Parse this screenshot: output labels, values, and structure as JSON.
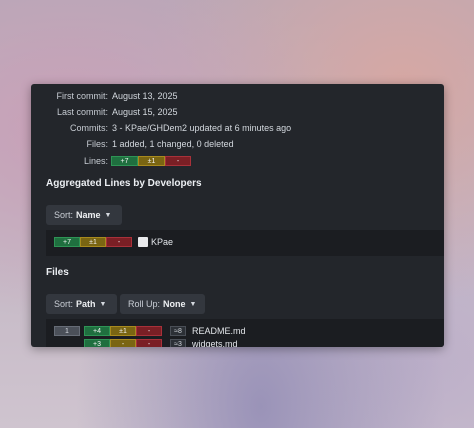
{
  "summary": {
    "first_commit_label": "First commit:",
    "first_commit_value": "August 13, 2025",
    "last_commit_label": "Last commit:",
    "last_commit_value": "August 15, 2025",
    "commits_label": "Commits:",
    "commits_value": "3 - KPae/GHDem2 updated at 6 minutes ago",
    "files_label": "Files:",
    "files_value": "1 added, 1 changed, 0 deleted",
    "lines_label": "Lines:",
    "lines_badges": {
      "added": "+7",
      "changed": "±1",
      "deleted": "-"
    }
  },
  "developers_section": {
    "title": "Aggregated Lines by Developers",
    "sort_label": "Sort:",
    "sort_value": "Name",
    "rows": [
      {
        "added": "+7",
        "changed": "±1",
        "deleted": "-",
        "name": "KPae"
      }
    ]
  },
  "files_section": {
    "title": "Files",
    "sort_label": "Sort:",
    "sort_value": "Path",
    "rollup_label": "Roll Up:",
    "rollup_value": "None",
    "rows": [
      {
        "index": "1",
        "added": "+4",
        "changed": "±1",
        "deleted": "-",
        "count": "≈8",
        "name": "README.md"
      },
      {
        "index": "",
        "added": "+3",
        "changed": "-",
        "deleted": "-",
        "count": "≈3",
        "name": "widgets.md"
      }
    ]
  },
  "colors": {
    "panel_bg": "#23262b",
    "added": "#1f6f3f",
    "changed": "#7a6512",
    "deleted": "#7a1f25"
  },
  "icons": {
    "dropdown": "chevron-down-icon",
    "avatar": "user-avatar"
  }
}
